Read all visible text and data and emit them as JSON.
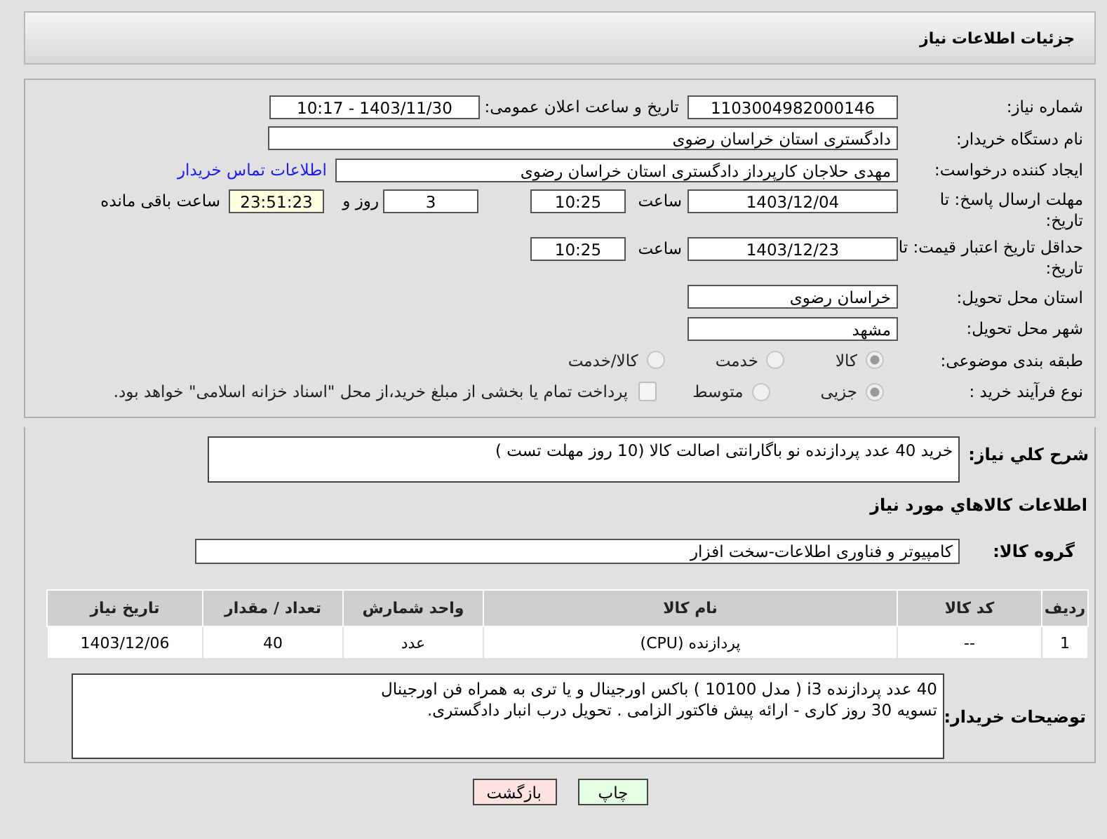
{
  "header": {
    "title": "جزئیات اطلاعات نیاز"
  },
  "need_number": {
    "label": "شماره نیاز:",
    "value": "1103004982000146"
  },
  "announce": {
    "label": "تاریخ و ساعت اعلان عمومی:",
    "value": "1403/11/30 - 10:17"
  },
  "buyer_org": {
    "label": "نام دستگاه خریدار:",
    "value": "دادگستری استان خراسان رضوی"
  },
  "requester": {
    "label": "ایجاد کننده درخواست:",
    "value": "مهدی حلاجان کارپرداز دادگستری استان خراسان رضوی",
    "link": "اطلاعات تماس خریدار"
  },
  "response_deadline": {
    "label": "مهلت ارسال پاسخ: تا تاریخ:",
    "date": "1403/12/04",
    "time_label": "ساعت",
    "time": "10:25",
    "days": "3",
    "days_label": "روز و",
    "remaining": "23:51:23",
    "remaining_label": "ساعت باقی مانده"
  },
  "price_validity": {
    "label": "حداقل تاریخ اعتبار قیمت: تا تاریخ:",
    "date": "1403/12/23",
    "time_label": "ساعت",
    "time": "10:25"
  },
  "province": {
    "label": "استان محل تحویل:",
    "value": "خراسان رضوی"
  },
  "city": {
    "label": "شهر محل تحویل:",
    "value": "مشهد"
  },
  "category": {
    "label": "طبقه بندی موضوعی:",
    "options": [
      {
        "label": "کالا",
        "selected": true
      },
      {
        "label": "خدمت",
        "selected": false
      },
      {
        "label": "کالا/خدمت",
        "selected": false
      }
    ]
  },
  "process": {
    "label": "نوع فرآیند خرید :",
    "options": [
      {
        "label": "جزیی",
        "selected": true
      },
      {
        "label": "متوسط",
        "selected": false
      }
    ],
    "payment_checkbox": {
      "checked": false,
      "label": "پرداخت تمام یا بخشی از مبلغ خرید،از محل \"اسناد خزانه اسلامی\" خواهد بود."
    }
  },
  "description": {
    "label": "شرح کلي نياز:",
    "value": "خرید 40 عدد پردازنده نو باگارانتی اصالت کالا (10 روز مهلت تست )"
  },
  "goods_title": "اطلاعات کالاهاي مورد نياز",
  "goods_group": {
    "label": "گروه کالا:",
    "value": "کامپیوتر و فناوری اطلاعات-سخت افزار"
  },
  "table": {
    "columns": [
      "ردیف",
      "کد کالا",
      "نام کالا",
      "واحد شمارش",
      "تعداد / مقدار",
      "تاریخ نیاز"
    ],
    "rows": [
      [
        "1",
        "--",
        "پردازنده (CPU)",
        "عدد",
        "40",
        "1403/12/06"
      ]
    ]
  },
  "buyer_notes": {
    "label": "توضیحات خریدار:",
    "lines": [
      "40 عدد پردازنده i3 ( مدل 10100 ) باکس اورجینال و یا تری به همراه فن اورجینال",
      "تسویه 30 روز کاری - ارائه پیش فاکتور الزامی . تحویل درب انبار دادگستری."
    ]
  },
  "buttons": [
    {
      "label": "چاپ",
      "kind": "print"
    },
    {
      "label": "بازگشت",
      "kind": "back"
    }
  ]
}
